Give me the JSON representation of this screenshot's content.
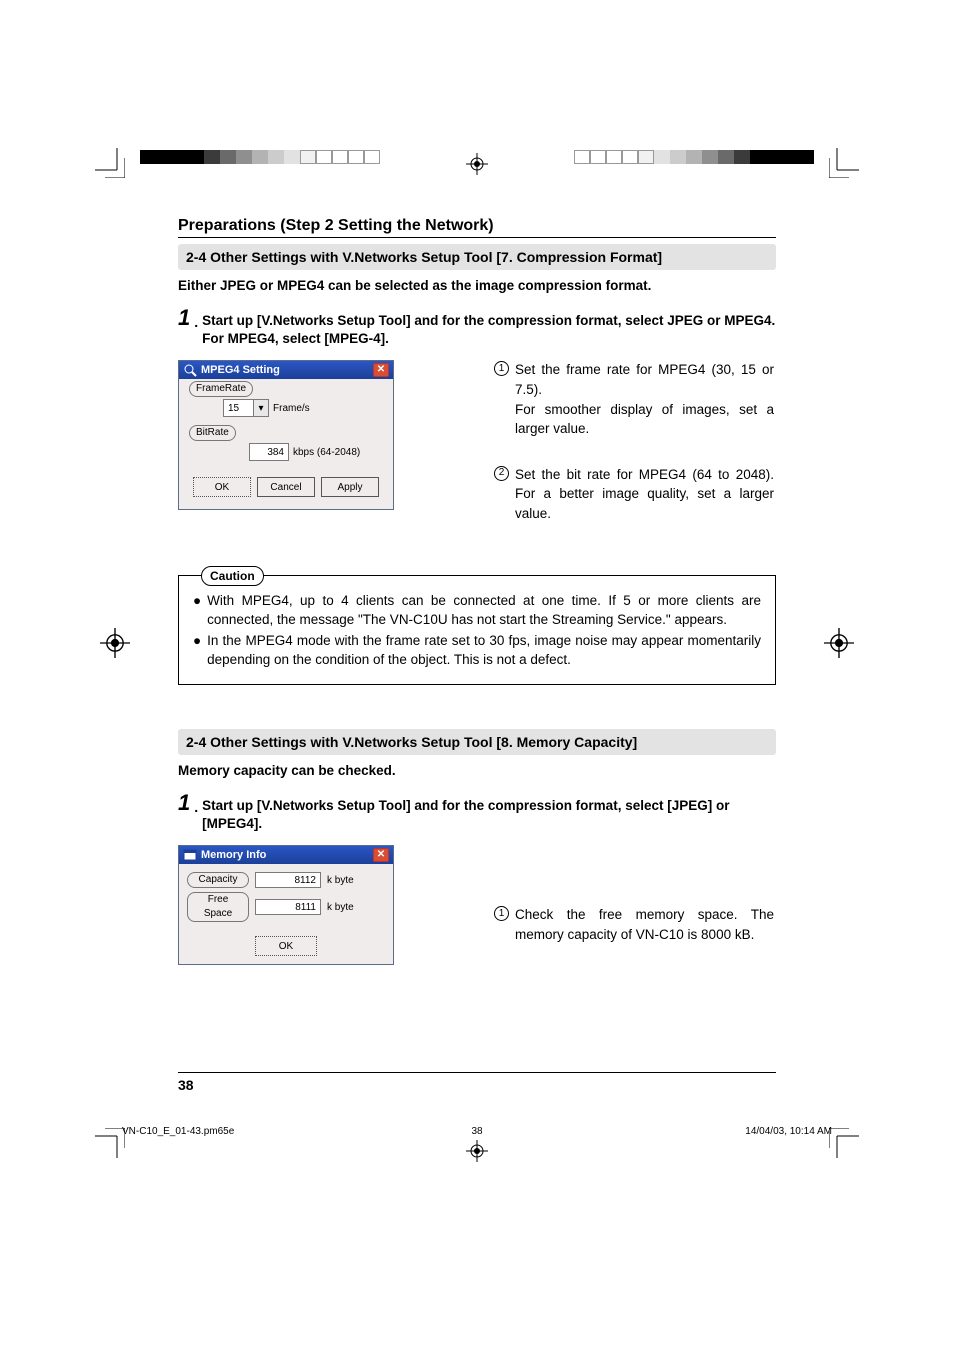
{
  "header": "Preparations (Step 2 Setting the Network)",
  "sectionA": {
    "bar": "2-4 Other Settings with V.Networks Setup Tool [7. Compression Format]",
    "lead": "Either JPEG or MPEG4 can be selected as the image compression format.",
    "step_num": "1",
    "step_text": "Start up [V.Networks Setup Tool] and for the compression format, select JPEG or MPEG4. For MPEG4, select [MPEG-4].",
    "dialog": {
      "title": "MPEG4 Setting",
      "grp_frame": "FrameRate",
      "frame_value": "15",
      "frame_unit": "Frame/s",
      "grp_bitrate": "BitRate",
      "bitrate_value": "384",
      "bitrate_unit": "kbps (64-2048)",
      "btn_ok": "OK",
      "btn_cancel": "Cancel",
      "btn_apply": "Apply"
    },
    "note1_num": "1",
    "note1": "Set the frame rate for MPEG4 (30, 15 or 7.5).\nFor smoother display of images, set a larger value.",
    "note2_num": "2",
    "note2": "Set the bit rate for MPEG4 (64 to 2048). For a better image quality, set a larger value."
  },
  "caution": {
    "label": "Caution",
    "items": [
      "With MPEG4, up to 4 clients can be connected at one time. If 5 or more clients are connected, the message \"The VN-C10U has not start the Streaming Service.\" appears.",
      "In the MPEG4 mode with the frame rate set to 30 fps, image noise may appear momentarily depending on the condition of the object. This is not a defect."
    ]
  },
  "sectionB": {
    "bar_prefix": "2-4 Other Settings with V.Networks Setup Tool [8. ",
    "bar_strong": "Memory Capacity",
    "bar_suffix": "]",
    "lead": "Memory capacity can be checked.",
    "step_num": "1",
    "step_text": "Start up [V.Networks Setup Tool] and for the compression format, select [JPEG] or [MPEG4].",
    "dialog": {
      "title": "Memory Info",
      "row1_label": "Capacity",
      "row1_value": "8112",
      "row1_unit": "k byte",
      "row2_label": "Free Space",
      "row2_value": "8111",
      "row2_unit": "k byte",
      "btn_ok": "OK"
    },
    "note1_num": "1",
    "note1": "Check the free memory space. The memory capacity of VN-C10 is 8000 kB."
  },
  "page_number": "38",
  "footer": {
    "left": "VN-C10_E_01-43.pm65e",
    "center": "38",
    "right": "14/04/03, 10:14 AM"
  }
}
